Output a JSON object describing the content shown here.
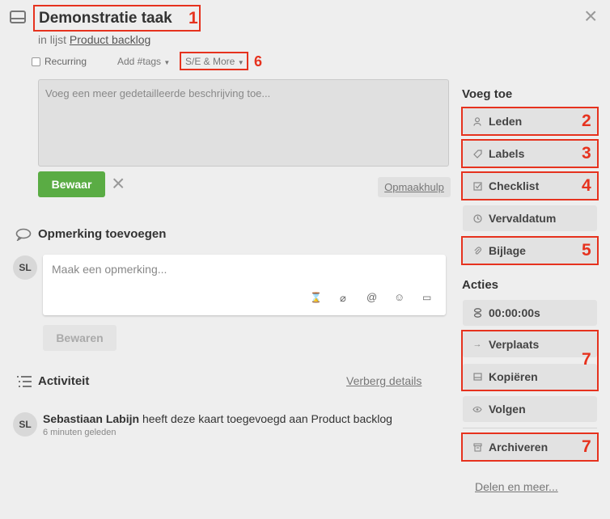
{
  "header": {
    "title": "Demonstratie taak",
    "list_prefix": "in lijst",
    "list_name": "Product backlog",
    "close_symbol": "×",
    "card_icon": "card-icon"
  },
  "toolbar": {
    "recurring_label": "Recurring",
    "add_tags_label": "Add #tags",
    "se_more_label": "S/E & More"
  },
  "description": {
    "placeholder": "Voeg een meer gedetailleerde beschrijving toe...",
    "save_label": "Bewaar",
    "cancel_symbol": "×",
    "format_help_label": "Opmaakhulp"
  },
  "comment": {
    "title": "Opmerking toevoegen",
    "avatar_initials": "SL",
    "placeholder": "Maak een opmerking...",
    "save_label": "Bewaren"
  },
  "activity": {
    "title": "Activiteit",
    "hide_details_label": "Verberg details",
    "entries": [
      {
        "avatar_initials": "SL",
        "user": "Sebastiaan Labijn",
        "text": "heeft deze kaart toegevoegd aan Product backlog",
        "time": "6 minuten geleden"
      }
    ]
  },
  "sidebar": {
    "add_title": "Voeg toe",
    "add_items": [
      {
        "label": "Leden",
        "icon": "person-icon"
      },
      {
        "label": "Labels",
        "icon": "tag-icon"
      },
      {
        "label": "Checklist",
        "icon": "checkbox-icon"
      },
      {
        "label": "Vervaldatum",
        "icon": "clock-icon"
      },
      {
        "label": "Bijlage",
        "icon": "paperclip-icon"
      }
    ],
    "actions_title": "Acties",
    "action_items": [
      {
        "label": "00:00:00s",
        "icon": "timer-icon"
      },
      {
        "label": "Verplaats",
        "icon": "arrow-right-icon"
      },
      {
        "label": "Kopiëren",
        "icon": "card-icon"
      },
      {
        "label": "Volgen",
        "icon": "eye-icon"
      },
      {
        "label": "Archiveren",
        "icon": "archive-icon"
      }
    ],
    "share_label": "Delen en meer..."
  },
  "annotations": [
    "1",
    "2",
    "3",
    "4",
    "5",
    "6",
    "7",
    "7"
  ],
  "colors": {
    "highlight": "#e6321e",
    "save_button": "#5aac44",
    "background": "#eeeeee"
  }
}
